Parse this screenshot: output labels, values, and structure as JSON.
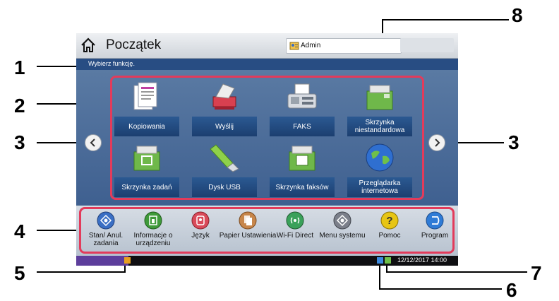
{
  "screen": {
    "title": "Początek",
    "message": "Wybierz funkcję.",
    "user_label": "Admin",
    "datetime": "12/12/2017 14:00"
  },
  "apps": [
    {
      "label": "Kopiowania",
      "icon": "copy-icon"
    },
    {
      "label": "Wyślij",
      "icon": "send-icon"
    },
    {
      "label": "FAKS",
      "icon": "fax-icon"
    },
    {
      "label": "Skrzynka niestandardowa",
      "icon": "custom-box-icon"
    },
    {
      "label": "Skrzynka zadań",
      "icon": "job-box-icon"
    },
    {
      "label": "Dysk USB",
      "icon": "usb-drive-icon"
    },
    {
      "label": "Skrzynka faksów",
      "icon": "fax-box-icon"
    },
    {
      "label": "Przeglądarka internetowa",
      "icon": "globe-icon"
    }
  ],
  "quick_buttons": [
    {
      "label": "Stan/ Anul. zadania",
      "icon": "status-icon",
      "color": "#3b6fc4"
    },
    {
      "label": "Informacje o urządzeniu",
      "icon": "device-info-icon",
      "color": "#3f9a3a"
    },
    {
      "label": "Język",
      "icon": "language-icon",
      "color": "#d94a5a"
    },
    {
      "label": "Papier Ustawienia",
      "icon": "paper-icon",
      "color": "#c7864b"
    },
    {
      "label": "Wi-Fi Direct",
      "icon": "wifi-icon",
      "color": "#3aa15a"
    },
    {
      "label": "Menu systemu",
      "icon": "system-menu-icon",
      "color": "#7b7f8a"
    },
    {
      "label": "Pomoc",
      "icon": "help-icon",
      "color": "#e7c514"
    },
    {
      "label": "Program",
      "icon": "program-icon",
      "color": "#2f7bd6"
    }
  ],
  "callouts": [
    "1",
    "2",
    "3",
    "3",
    "4",
    "5",
    "6",
    "7",
    "8"
  ],
  "colors": {
    "frame_highlight": "#e33b5b",
    "screen_background": "#4a6a93",
    "tile_label": "#2b5992"
  }
}
